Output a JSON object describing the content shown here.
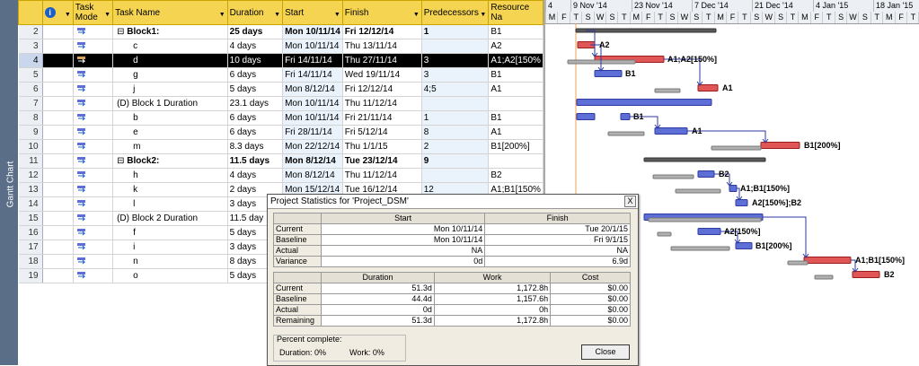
{
  "sidebar": {
    "label": "Gantt Chart"
  },
  "columns": [
    "Task Mode",
    "Task Name",
    "Duration",
    "Start",
    "Finish",
    "Predecessors",
    "Resource Na"
  ],
  "rows": [
    {
      "n": "2",
      "name": "Block1:",
      "dur": "25 days",
      "start": "Mon 10/11/14",
      "finish": "Fri 12/12/14",
      "pred": "1",
      "res": "B1",
      "bold": true,
      "collapsed": true
    },
    {
      "n": "3",
      "name": "c",
      "dur": "4 days",
      "start": "Mon 10/11/14",
      "finish": "Thu 13/11/14",
      "pred": "",
      "res": "A2"
    },
    {
      "n": "4",
      "name": "d",
      "dur": "10 days",
      "start": "Fri 14/11/14",
      "finish": "Thu 27/11/14",
      "pred": "3",
      "res": "A1;A2[150%",
      "sel": true
    },
    {
      "n": "5",
      "name": "g",
      "dur": "6 days",
      "start": "Fri 14/11/14",
      "finish": "Wed 19/11/14",
      "pred": "3",
      "res": "B1"
    },
    {
      "n": "6",
      "name": "j",
      "dur": "5 days",
      "start": "Mon 8/12/14",
      "finish": "Fri 12/12/14",
      "pred": "4;5",
      "res": "A1"
    },
    {
      "n": "7",
      "name": "(D) Block 1 Duration",
      "dur": "23.1 days",
      "start": "Mon 10/11/14",
      "finish": "Thu 11/12/14",
      "pred": "",
      "res": ""
    },
    {
      "n": "8",
      "name": "b",
      "dur": "6 days",
      "start": "Mon 10/11/14",
      "finish": "Fri 21/11/14",
      "pred": "1",
      "res": "B1"
    },
    {
      "n": "9",
      "name": "e",
      "dur": "6 days",
      "start": "Fri 28/11/14",
      "finish": "Fri 5/12/14",
      "pred": "8",
      "res": "A1"
    },
    {
      "n": "10",
      "name": "m",
      "dur": "8.3 days",
      "start": "Mon 22/12/14",
      "finish": "Thu 1/1/15",
      "pred": "2",
      "res": "B1[200%]"
    },
    {
      "n": "11",
      "name": "Block2:",
      "dur": "11.5 days",
      "start": "Mon 8/12/14",
      "finish": "Tue 23/12/14",
      "pred": "9",
      "res": "",
      "bold": true,
      "collapsed": true
    },
    {
      "n": "12",
      "name": "h",
      "dur": "4 days",
      "start": "Mon 8/12/14",
      "finish": "Thu 11/12/14",
      "pred": "",
      "res": "B2"
    },
    {
      "n": "13",
      "name": "k",
      "dur": "2 days",
      "start": "Mon 15/12/14",
      "finish": "Tue 16/12/14",
      "pred": "12",
      "res": "A1;B1[150%"
    },
    {
      "n": "14",
      "name": "l",
      "dur": "3 days",
      "start": "",
      "finish": "",
      "pred": "",
      "res": ""
    },
    {
      "n": "15",
      "name": "(D) Block 2 Duration",
      "dur": "11.5 day",
      "start": "",
      "finish": "",
      "pred": "",
      "res": ""
    },
    {
      "n": "16",
      "name": "f",
      "dur": "5 days",
      "start": "",
      "finish": "",
      "pred": "",
      "res": ""
    },
    {
      "n": "17",
      "name": "i",
      "dur": "3 days",
      "start": "",
      "finish": "",
      "pred": "",
      "res": ""
    },
    {
      "n": "18",
      "name": "n",
      "dur": "8 days",
      "start": "",
      "finish": "",
      "pred": "",
      "res": ""
    },
    {
      "n": "19",
      "name": "o",
      "dur": "5 days",
      "start": "",
      "finish": "",
      "pred": "",
      "res": ""
    }
  ],
  "gantt": {
    "weeks": [
      "4",
      "9 Nov '14",
      "23 Nov '14",
      "7 Dec '14",
      "21 Dec '14",
      "4 Jan '15",
      "18 Jan '15"
    ],
    "days": [
      "M",
      "F",
      "T",
      "S",
      "W",
      "S",
      "T",
      "M",
      "F",
      "T",
      "S",
      "W",
      "S",
      "T",
      "M",
      "F",
      "T",
      "S",
      "W",
      "S",
      "T",
      "M",
      "F",
      "T",
      "S",
      "W",
      "S",
      "T",
      "M",
      "F",
      "T",
      "S"
    ],
    "labels": [
      "A2",
      "A1;A2[150%]",
      "B1",
      "A1",
      "B1",
      "A1",
      "B1[200%]",
      "B2",
      "A1;B1[150%]",
      "A2[150%];B2",
      "A2[150%]",
      "B1[200%]",
      "A1;B1[150%]",
      "B2"
    ]
  },
  "dialog": {
    "title": "Project Statistics for 'Project_DSM'",
    "close_x": "X",
    "dates_header": [
      "",
      "Start",
      "Finish"
    ],
    "dates": [
      {
        "label": "Current",
        "start": "Mon 10/11/14",
        "finish": "Tue 20/1/15"
      },
      {
        "label": "Baseline",
        "start": "Mon 10/11/14",
        "finish": "Fri 9/1/15"
      },
      {
        "label": "Actual",
        "start": "NA",
        "finish": "NA"
      },
      {
        "label": "Variance",
        "start": "0d",
        "finish": "6.9d"
      }
    ],
    "stats_header": [
      "",
      "Duration",
      "Work",
      "Cost"
    ],
    "stats": [
      {
        "label": "Current",
        "duration": "51.3d",
        "work": "1,172.8h",
        "cost": "$0.00"
      },
      {
        "label": "Baseline",
        "duration": "44.4d",
        "work": "1,157.6h",
        "cost": "$0.00"
      },
      {
        "label": "Actual",
        "duration": "0d",
        "work": "0h",
        "cost": "$0.00"
      },
      {
        "label": "Remaining",
        "duration": "51.3d",
        "work": "1,172.8h",
        "cost": "$0.00"
      }
    ],
    "percent_title": "Percent complete:",
    "percent_duration": "Duration:  0%",
    "percent_work": "Work:  0%",
    "close_button": "Close"
  }
}
